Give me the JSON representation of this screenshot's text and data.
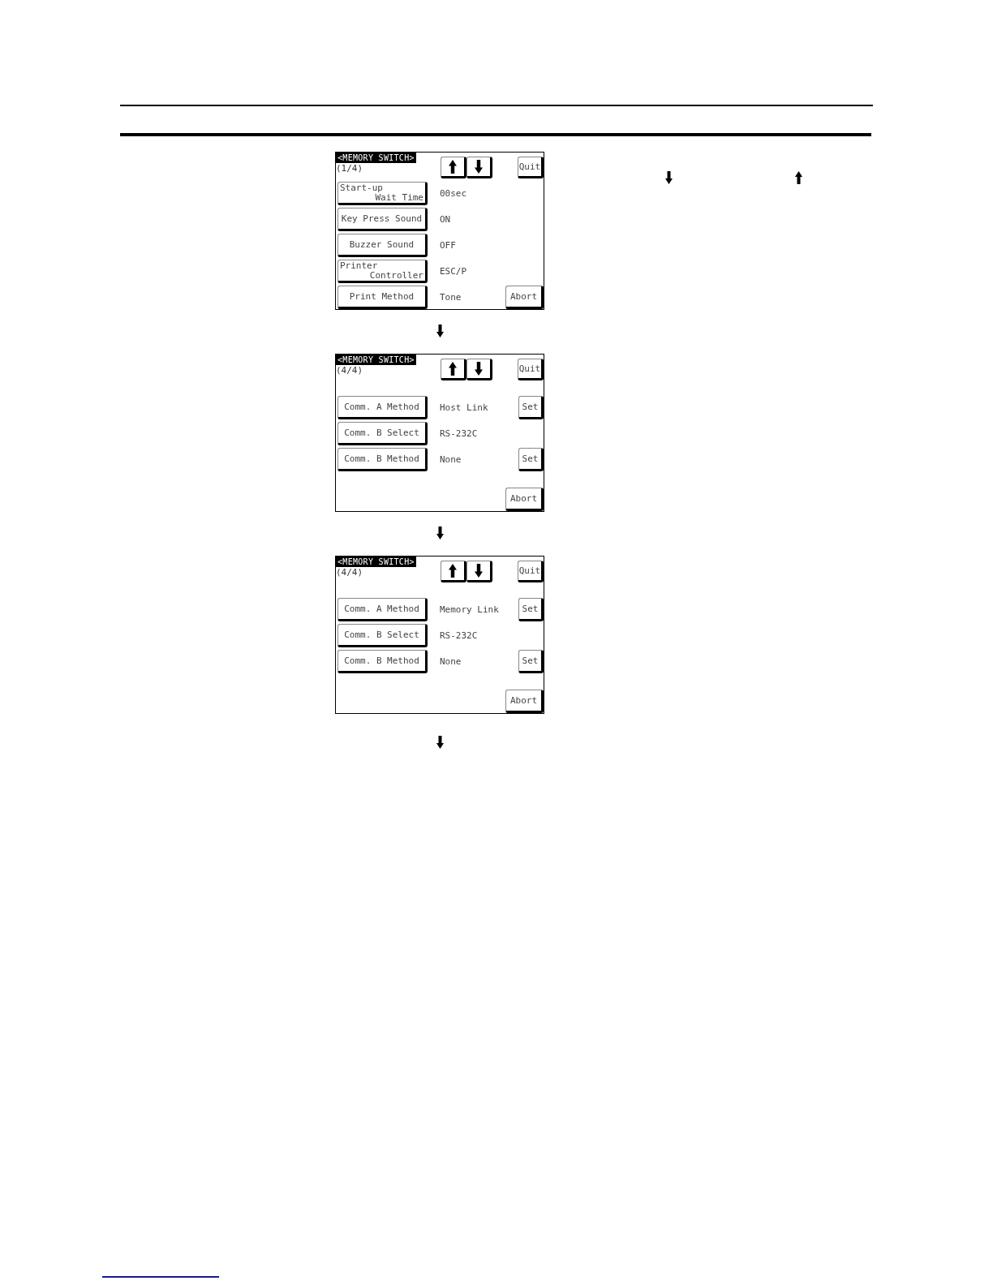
{
  "screens": [
    {
      "title": "<MEMORY SWITCH>",
      "page": "(1/4)",
      "quit": "Quit",
      "abort": "Abort",
      "rows": [
        {
          "label": [
            "Start-up",
            "Wait Time"
          ],
          "value": "00sec"
        },
        {
          "label": [
            "Key Press Sound"
          ],
          "value": "ON"
        },
        {
          "label": [
            "Buzzer Sound"
          ],
          "value": "OFF"
        },
        {
          "label": [
            "Printer",
            "Controller"
          ],
          "value": "ESC/P"
        },
        {
          "label": [
            "Print Method"
          ],
          "value": "Tone"
        }
      ]
    },
    {
      "title": "<MEMORY SWITCH>",
      "page": "(4/4)",
      "quit": "Quit",
      "abort": "Abort",
      "rows": [
        {
          "label": [
            "Comm. A Method"
          ],
          "value": "Host Link",
          "set": "Set"
        },
        {
          "label": [
            "Comm. B Select"
          ],
          "value": "RS-232C"
        },
        {
          "label": [
            "Comm. B Method"
          ],
          "value": "None",
          "set": "Set"
        }
      ]
    },
    {
      "title": "<MEMORY SWITCH>",
      "page": "(4/4)",
      "quit": "Quit",
      "abort": "Abort",
      "rows": [
        {
          "label": [
            "Comm. A Method"
          ],
          "value": "Memory Link",
          "set": "Set"
        },
        {
          "label": [
            "Comm. B Select"
          ],
          "value": "RS-232C"
        },
        {
          "label": [
            "Comm. B Method"
          ],
          "value": "None",
          "set": "Set"
        }
      ]
    }
  ]
}
